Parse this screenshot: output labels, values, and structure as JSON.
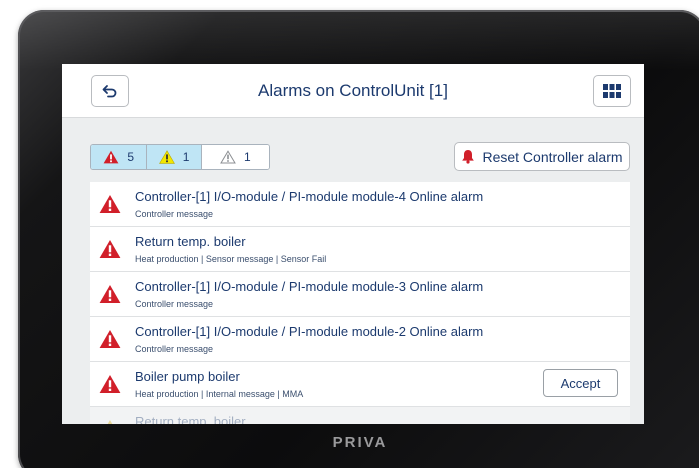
{
  "device": {
    "brand": "PRIVA"
  },
  "header": {
    "title": "Alarms on ControlUnit [1]",
    "back_icon": "back-arrow-icon",
    "apps_icon": "grid-icon"
  },
  "filters": [
    {
      "name": "critical",
      "count": "5",
      "color": "#d11f2a",
      "icon": "warning-triangle-red-icon"
    },
    {
      "name": "warning",
      "count": "1",
      "color": "#f2e600",
      "icon": "warning-triangle-yellow-icon"
    },
    {
      "name": "info",
      "count": "1",
      "color": "#ffffff",
      "icon": "warning-triangle-grey-icon"
    }
  ],
  "reset_button": {
    "label": "Reset Controller alarm",
    "icon": "bell-icon",
    "icon_color": "#d11f2a"
  },
  "alarms": [
    {
      "title": "Controller-[1] I/O-module / PI-module module-4 Online alarm",
      "subtitle": "Controller message"
    },
    {
      "title": "Return temp. boiler",
      "subtitle": "Heat production | Sensor message | Sensor Fail"
    },
    {
      "title": "Controller-[1] I/O-module / PI-module module-3 Online alarm",
      "subtitle": "Controller message"
    },
    {
      "title": "Controller-[1] I/O-module / PI-module module-2 Online alarm",
      "subtitle": "Controller message"
    },
    {
      "title": "Boiler pump boiler",
      "subtitle": "Heat production | Internal message | MMA",
      "action": "Accept"
    },
    {
      "title": "Return temp. boiler",
      "subtitle": ""
    }
  ],
  "colors": {
    "accent_text": "#1c3a6e",
    "alarm_red": "#d11f2a",
    "filter_selected": "#bfe5f5"
  }
}
